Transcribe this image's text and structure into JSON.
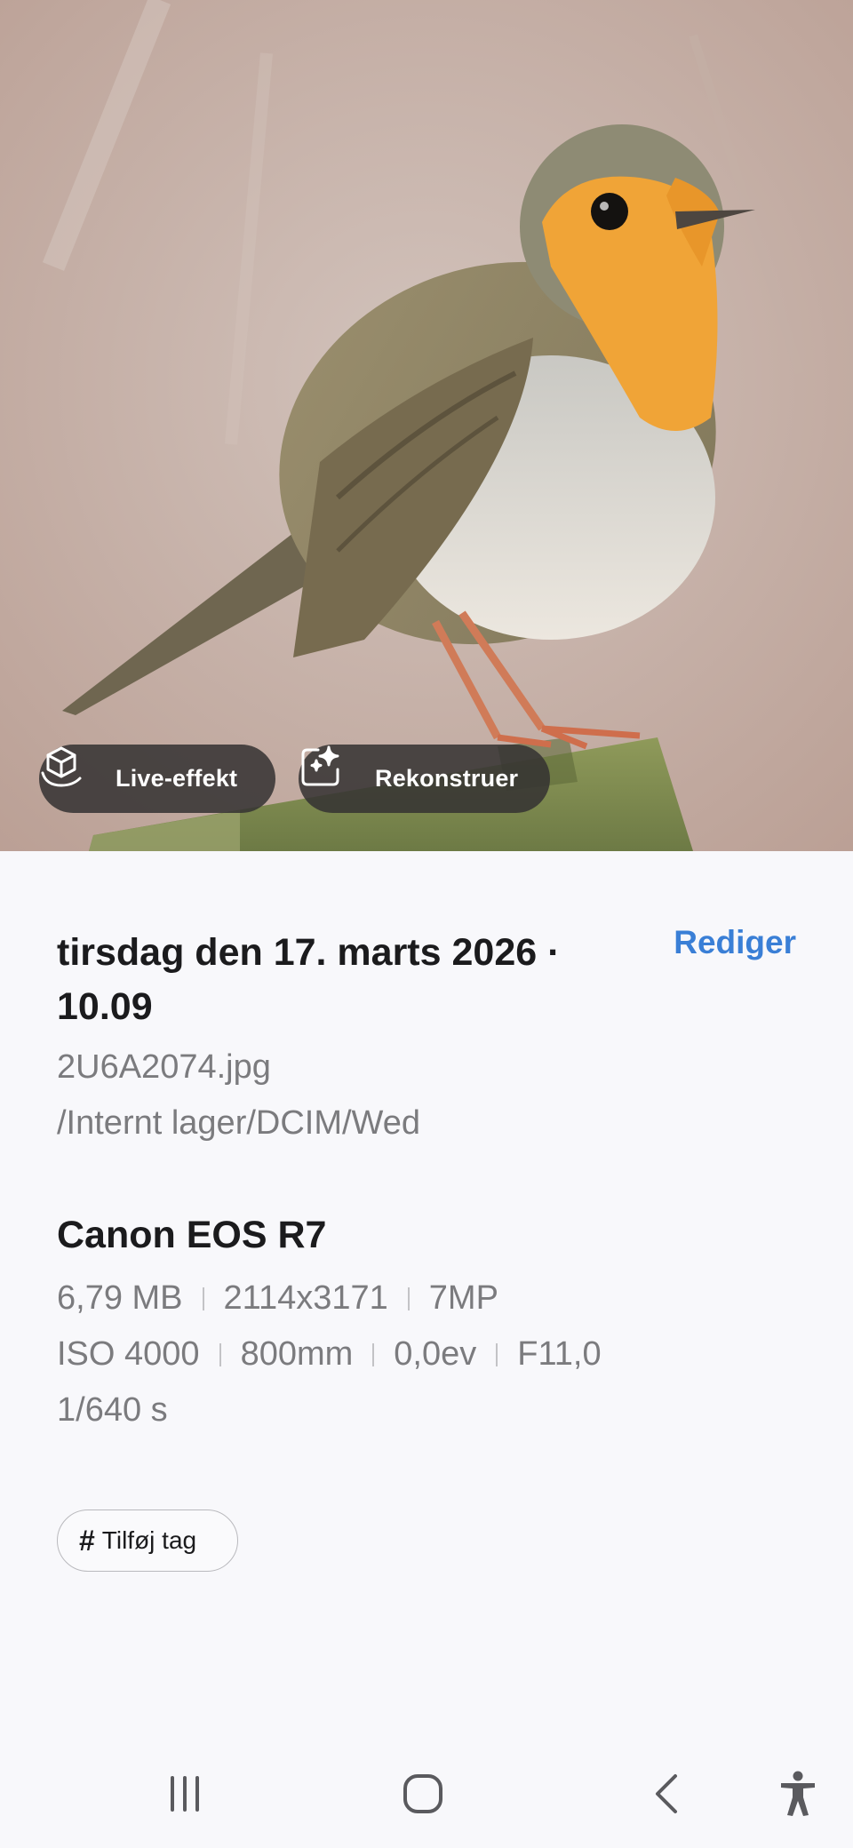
{
  "photo": {
    "chips": {
      "live_label": "Live-effekt",
      "reconstruct_label": "Rekonstruer"
    }
  },
  "details": {
    "date_line": "tirsdag den 17. marts 2026 · 10.09",
    "edit_label": "Rediger",
    "filename": "2U6A2074.jpg",
    "path": "/Internt lager/DCIM/Wed",
    "camera": "Canon EOS R7",
    "file_size": "6,79 MB",
    "resolution": "2114x3171",
    "megapixels": "7MP",
    "iso": "ISO 4000",
    "focal_length": "800mm",
    "exposure_comp": "0,0ev",
    "aperture": "F11,0",
    "shutter": "1/640 s",
    "tag_label": "Tilføj tag",
    "tag_symbol": "#"
  },
  "colors": {
    "accent": "#3a7fd6",
    "chip_bg": "#343232",
    "page_bg": "#f8f8fb"
  },
  "icons": {
    "live": "cube-hand-icon",
    "reconstruct": "sparkle-image-icon",
    "nav_recent": "recent-apps-icon",
    "nav_home": "home-icon",
    "nav_back": "back-icon",
    "nav_accessibility": "accessibility-icon"
  }
}
